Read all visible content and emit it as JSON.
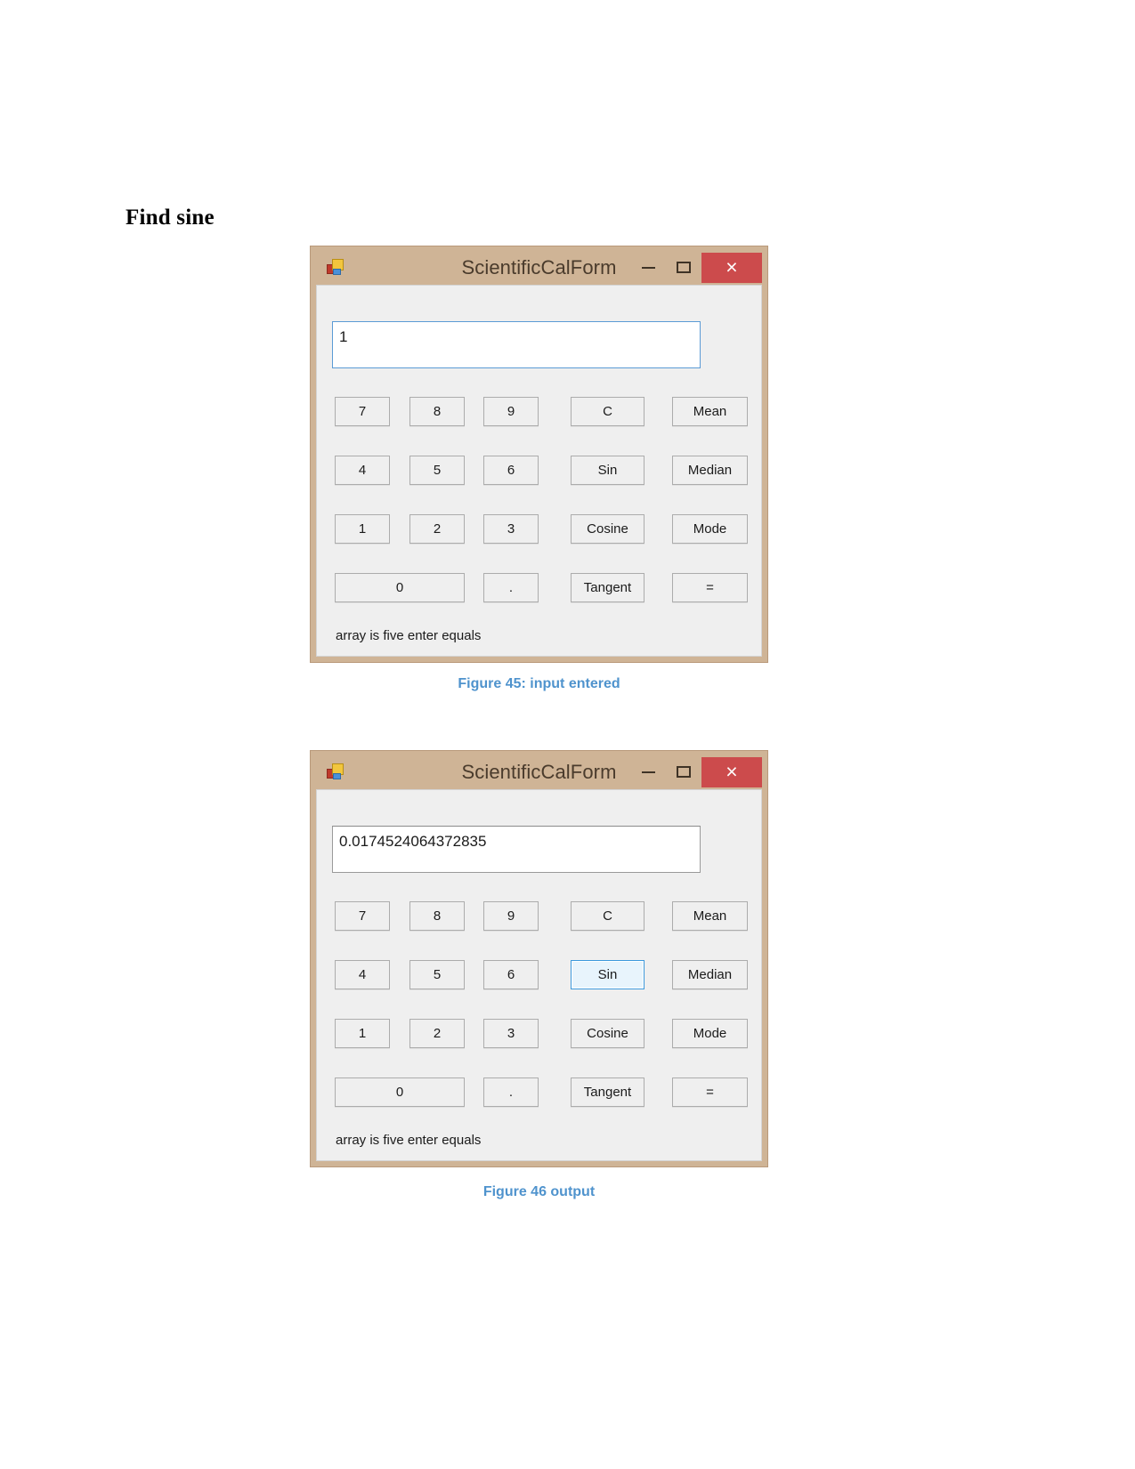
{
  "document": {
    "heading": "Find sine"
  },
  "colors": {
    "title_bar": "#cfb496",
    "close_button": "#cc4b4c",
    "client_background": "#efefef",
    "focus_border": "#5b9bd5",
    "caption_text": "#4f93cd",
    "button_border": "#acacac"
  },
  "window_controls": {
    "minimize_label": "–",
    "maximize_label": "□",
    "close_label": "×"
  },
  "figures": [
    {
      "caption": "Figure 45: input entered",
      "window": {
        "title": "ScientificCalForm",
        "icon": "visual-studio-form-icon",
        "display_value": "1",
        "display_focused": true,
        "status_text": "array is five enter equals",
        "focused_button": null,
        "buttons": [
          [
            {
              "label": "7",
              "name": "seven"
            },
            {
              "label": "8",
              "name": "eight"
            },
            {
              "label": "9",
              "name": "nine"
            },
            {
              "label": "C",
              "name": "clear"
            },
            {
              "label": "Mean",
              "name": "mean"
            }
          ],
          [
            {
              "label": "4",
              "name": "four"
            },
            {
              "label": "5",
              "name": "five"
            },
            {
              "label": "6",
              "name": "six"
            },
            {
              "label": "Sin",
              "name": "sin"
            },
            {
              "label": "Median",
              "name": "median"
            }
          ],
          [
            {
              "label": "1",
              "name": "one"
            },
            {
              "label": "2",
              "name": "two"
            },
            {
              "label": "3",
              "name": "three"
            },
            {
              "label": "Cosine",
              "name": "cosine"
            },
            {
              "label": "Mode",
              "name": "mode"
            }
          ],
          [
            {
              "label": "0",
              "name": "zero"
            },
            {
              "label": ".",
              "name": "decimal-point"
            },
            {
              "label": "Tangent",
              "name": "tangent"
            },
            {
              "label": "=",
              "name": "equals"
            }
          ]
        ]
      }
    },
    {
      "caption": "Figure 46  output",
      "window": {
        "title": "ScientificCalForm",
        "icon": "visual-studio-form-icon",
        "display_value": "0.0174524064372835",
        "display_focused": false,
        "status_text": "array is five enter equals",
        "focused_button": "Sin",
        "buttons": [
          [
            {
              "label": "7",
              "name": "seven"
            },
            {
              "label": "8",
              "name": "eight"
            },
            {
              "label": "9",
              "name": "nine"
            },
            {
              "label": "C",
              "name": "clear"
            },
            {
              "label": "Mean",
              "name": "mean"
            }
          ],
          [
            {
              "label": "4",
              "name": "four"
            },
            {
              "label": "5",
              "name": "five"
            },
            {
              "label": "6",
              "name": "six"
            },
            {
              "label": "Sin",
              "name": "sin"
            },
            {
              "label": "Median",
              "name": "median"
            }
          ],
          [
            {
              "label": "1",
              "name": "one"
            },
            {
              "label": "2",
              "name": "two"
            },
            {
              "label": "3",
              "name": "three"
            },
            {
              "label": "Cosine",
              "name": "cosine"
            },
            {
              "label": "Mode",
              "name": "mode"
            }
          ],
          [
            {
              "label": "0",
              "name": "zero"
            },
            {
              "label": ".",
              "name": "decimal-point"
            },
            {
              "label": "Tangent",
              "name": "tangent"
            },
            {
              "label": "=",
              "name": "equals"
            }
          ]
        ]
      }
    }
  ]
}
